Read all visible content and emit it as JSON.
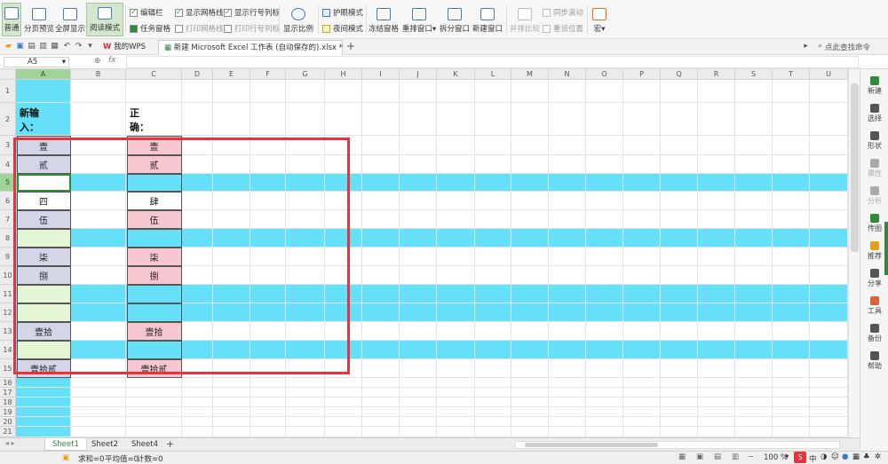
{
  "ribbon": {
    "normal": "普通",
    "page_break": "分页预览",
    "fullscreen": "全屏显示",
    "reading_mode": "阅读模式",
    "formula_bar": "编辑栏",
    "task_pane": "任务窗格",
    "show_gridlines": "显示网格线",
    "print_gridlines": "打印网格线",
    "show_headings": "显示行号列标",
    "print_headings": "打印行号列标",
    "zoom_ratio": "显示比例",
    "eye_protect": "护眼模式",
    "night_mode": "夜间模式",
    "freeze": "冻结窗格",
    "rearrange": "重排窗口",
    "split": "拆分窗口",
    "new_window": "新建窗口",
    "side_by_side": "并排比较",
    "sync_scroll": "同步滚动",
    "reset_pos": "重设位置",
    "macro": "宏"
  },
  "tabs": {
    "wps_home": "我的WPS",
    "doc_title": "新建 Microsoft Excel 工作表 (自动保存的).xlsx *",
    "search_hint": "点此查找命令"
  },
  "formula": {
    "cell_ref": "A5",
    "fx": "fx"
  },
  "columns": [
    "A",
    "B",
    "C",
    "D",
    "E",
    "F",
    "G",
    "H",
    "I",
    "J",
    "K",
    "L",
    "M",
    "N",
    "O",
    "P",
    "Q",
    "R",
    "S",
    "T",
    "U"
  ],
  "rows": [
    "1",
    "2",
    "3",
    "4",
    "5",
    "6",
    "7",
    "8",
    "9",
    "10",
    "11",
    "12",
    "13",
    "14",
    "15",
    "16",
    "17",
    "18",
    "19",
    "20",
    "21"
  ],
  "labels": {
    "new_input": "新输入：",
    "correct": "正确："
  },
  "cells": {
    "a3": "壹",
    "c3": "壹",
    "a4": "贰",
    "c4": "贰",
    "a6": "四",
    "c6": "肆",
    "a7": "伍",
    "c7": "伍",
    "a9": "柒",
    "c9": "柒",
    "a10": "捌",
    "c10": "捌",
    "a13": "壹拾",
    "c13": "壹拾",
    "a15": "壹拾贰",
    "c15": "壹拾贰"
  },
  "right_panel": [
    "新建",
    "选择",
    "形状",
    "属性",
    "分析",
    "传图",
    "推荐",
    "分享",
    "工具",
    "备份",
    "帮助"
  ],
  "sheets": [
    "Sheet1",
    "Sheet2",
    "Sheet4"
  ],
  "status": {
    "sum": "求和=0",
    "avg": "平均值=0",
    "count": "计数=0",
    "zoom": "100 %"
  },
  "colors": {
    "highlight_row": "#66e0f8",
    "pink_cell": "#f7c7cf",
    "lavender_cell": "#d5d5e8",
    "green_cell": "#e4f5d4",
    "accent": "#2e8b3a",
    "red_box": "#e8323c"
  }
}
